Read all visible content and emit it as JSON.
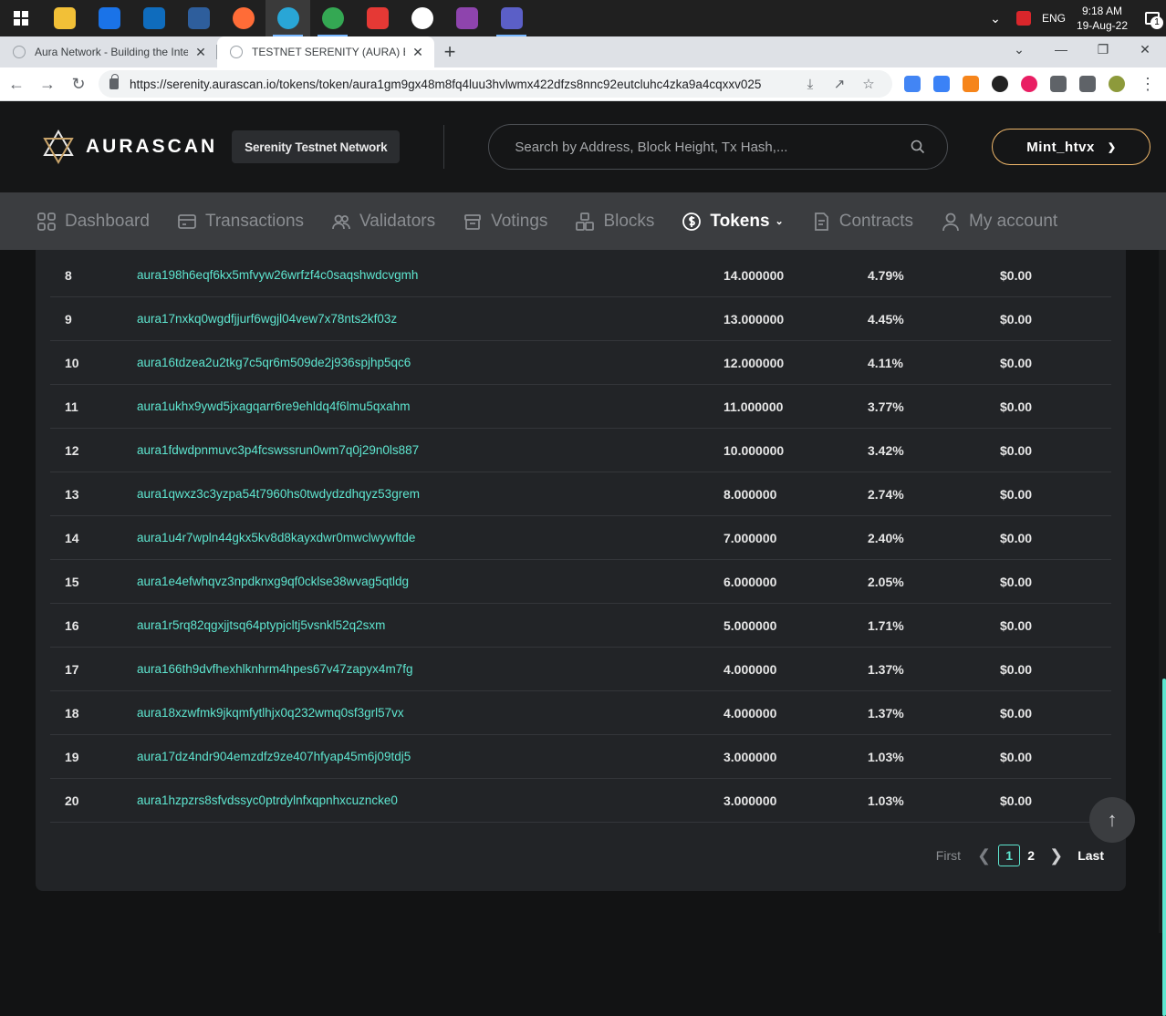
{
  "taskbar": {
    "apps": [
      {
        "name": "file-explorer",
        "color": "#f2c037",
        "active": false,
        "running": false
      },
      {
        "name": "mail",
        "color": "#1a73e8",
        "active": false,
        "running": false
      },
      {
        "name": "outlook",
        "color": "#0f6cbd",
        "active": false,
        "running": false
      },
      {
        "name": "mysql-workbench",
        "color": "#2e5e9c",
        "active": false,
        "running": false
      },
      {
        "name": "postman",
        "color": "#ff6c37",
        "active": false,
        "running": false
      },
      {
        "name": "edge",
        "color": "#29a6d6",
        "active": true,
        "running": true
      },
      {
        "name": "chrome",
        "color": "#34a853",
        "active": false,
        "running": true
      },
      {
        "name": "pdf-reader",
        "color": "#e53935",
        "active": false,
        "running": false
      },
      {
        "name": "ubuntu-vpn",
        "color": "#ffffff",
        "active": false,
        "running": false
      },
      {
        "name": "git-tool",
        "color": "#8e44ad",
        "active": false,
        "running": false
      },
      {
        "name": "teams",
        "color": "#5b5fc7",
        "active": false,
        "running": true
      }
    ],
    "language": "ENG",
    "time": "9:18 AM",
    "date": "19-Aug-22",
    "notifications": "1"
  },
  "browser": {
    "tabs": [
      {
        "title": "Aura Network - Building the Inter",
        "active": false
      },
      {
        "title": "TESTNET SERENITY (AURA) Block",
        "active": true
      }
    ],
    "url": "https://serenity.aurascan.io/tokens/token/aura1gm9gx48m8fq4luu3hvlwmx422dfzs8nnc92eutcluhc4zka9a4cqxxv025",
    "extensions": [
      {
        "name": "translate",
        "color": "#4285f4"
      },
      {
        "name": "keplr",
        "color": "#3b82f6"
      },
      {
        "name": "metamask",
        "color": "#f6851b"
      },
      {
        "name": "color-picker",
        "color": "#222222"
      },
      {
        "name": "color-wheel",
        "color": "#e91e63"
      },
      {
        "name": "extensions",
        "color": "#5f6368"
      },
      {
        "name": "side-panel",
        "color": "#5f6368"
      },
      {
        "name": "profile",
        "color": "#8d9a3b"
      }
    ]
  },
  "header": {
    "logo_text": "AURASCAN",
    "network": "Serenity Testnet Network",
    "search_placeholder": "Search by Address, Block Height, Tx Hash,...",
    "account": "Mint_htvx"
  },
  "nav": [
    {
      "label": "Dashboard",
      "icon": "dashboard-icon",
      "active": false
    },
    {
      "label": "Transactions",
      "icon": "transactions-icon",
      "active": false
    },
    {
      "label": "Validators",
      "icon": "validators-icon",
      "active": false
    },
    {
      "label": "Votings",
      "icon": "votings-icon",
      "active": false
    },
    {
      "label": "Blocks",
      "icon": "blocks-icon",
      "active": false
    },
    {
      "label": "Tokens",
      "icon": "tokens-icon",
      "active": true
    },
    {
      "label": "Contracts",
      "icon": "contracts-icon",
      "active": false
    },
    {
      "label": "My account",
      "icon": "account-icon",
      "active": false
    }
  ],
  "holders": [
    {
      "rank": "8",
      "address": "aura198h6eqf6kx5mfvyw26wrfzf4c0saqshwdcvgmh",
      "quantity": "14.000000",
      "percentage": "4.79%",
      "value": "$0.00"
    },
    {
      "rank": "9",
      "address": "aura17nxkq0wgdfjjurf6wgjl04vew7x78nts2kf03z",
      "quantity": "13.000000",
      "percentage": "4.45%",
      "value": "$0.00"
    },
    {
      "rank": "10",
      "address": "aura16tdzea2u2tkg7c5qr6m509de2j936spjhp5qc6",
      "quantity": "12.000000",
      "percentage": "4.11%",
      "value": "$0.00"
    },
    {
      "rank": "11",
      "address": "aura1ukhx9ywd5jxagqarr6re9ehldq4f6lmu5qxahm",
      "quantity": "11.000000",
      "percentage": "3.77%",
      "value": "$0.00"
    },
    {
      "rank": "12",
      "address": "aura1fdwdpnmuvc3p4fcswssrun0wm7q0j29n0ls887",
      "quantity": "10.000000",
      "percentage": "3.42%",
      "value": "$0.00"
    },
    {
      "rank": "13",
      "address": "aura1qwxz3c3yzpa54t7960hs0twdydzdhqyz53grem",
      "quantity": "8.000000",
      "percentage": "2.74%",
      "value": "$0.00"
    },
    {
      "rank": "14",
      "address": "aura1u4r7wpln44gkx5kv8d8kayxdwr0mwclwywftde",
      "quantity": "7.000000",
      "percentage": "2.40%",
      "value": "$0.00"
    },
    {
      "rank": "15",
      "address": "aura1e4efwhqvz3npdknxg9qf0cklse38wvag5qtldg",
      "quantity": "6.000000",
      "percentage": "2.05%",
      "value": "$0.00"
    },
    {
      "rank": "16",
      "address": "aura1r5rq82qgxjjtsq64ptypjcltj5vsnkl52q2sxm",
      "quantity": "5.000000",
      "percentage": "1.71%",
      "value": "$0.00"
    },
    {
      "rank": "17",
      "address": "aura166th9dvfhexhlknhrm4hpes67v47zapyx4m7fg",
      "quantity": "4.000000",
      "percentage": "1.37%",
      "value": "$0.00"
    },
    {
      "rank": "18",
      "address": "aura18xzwfmk9jkqmfytlhjx0q232wmq0sf3grl57vx",
      "quantity": "4.000000",
      "percentage": "1.37%",
      "value": "$0.00"
    },
    {
      "rank": "19",
      "address": "aura17dz4ndr904emzdfz9ze407hfyap45m6j09tdj5",
      "quantity": "3.000000",
      "percentage": "1.03%",
      "value": "$0.00"
    },
    {
      "rank": "20",
      "address": "aura1hzpzrs8sfvdssyc0ptrdylnfxqpnhxcuzncke0",
      "quantity": "3.000000",
      "percentage": "1.03%",
      "value": "$0.00"
    }
  ],
  "pagination": {
    "first": "First",
    "pages": [
      "1",
      "2"
    ],
    "current": "1",
    "last": "Last"
  },
  "colors": {
    "accent": "#5ee6d0",
    "account_border": "#f0b86b",
    "background": "#121314",
    "card": "#222427"
  }
}
